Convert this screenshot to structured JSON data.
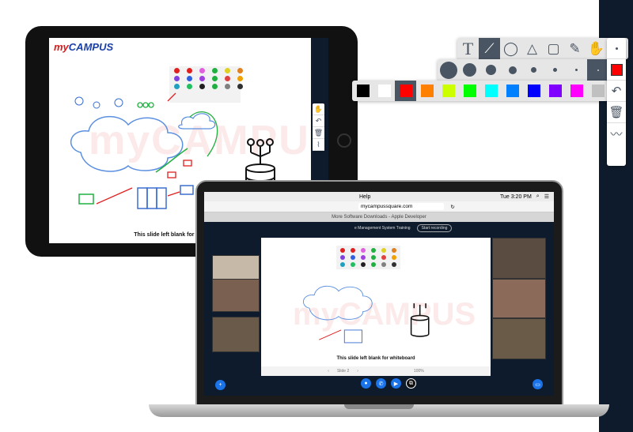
{
  "toolbar": {
    "tools": [
      "text-tool",
      "line-tool",
      "circle-tool",
      "triangle-tool",
      "rectangle-tool",
      "pencil-tool",
      "hand-tool",
      "line-tool-current"
    ],
    "text_glyph": "T",
    "selected_tool": "line-tool",
    "sizes": [
      22,
      17,
      13,
      10,
      7,
      5,
      3,
      2
    ],
    "selected_size_index": 7,
    "colors": [
      "#000000",
      "#ffffff",
      "#ff0000",
      "#ff8000",
      "#ccff00",
      "#00ff00",
      "#00ffff",
      "#0080ff",
      "#0000ff",
      "#8000ff",
      "#ff00ff",
      "#c0c0c0"
    ],
    "selected_color": "#ff0000",
    "side": [
      "current-size",
      "current-color",
      "undo",
      "delete",
      "graph"
    ]
  },
  "ipad": {
    "logo_my": "my",
    "logo_campus": "CAMPUS",
    "caption": "This slide left blank for whiteboard",
    "watermark": "myCAMPUS"
  },
  "laptop": {
    "menu_item": "Help",
    "clock": "Tue 3:20 PM",
    "url": "mycampussquare.com",
    "tab_title": "More Software Downloads - Apple Developer",
    "course": "e Management System Training",
    "record": "Start recording",
    "caption": "This slide left blank for whiteboard",
    "slide_label": "Slide 2",
    "zoom": "100%"
  }
}
